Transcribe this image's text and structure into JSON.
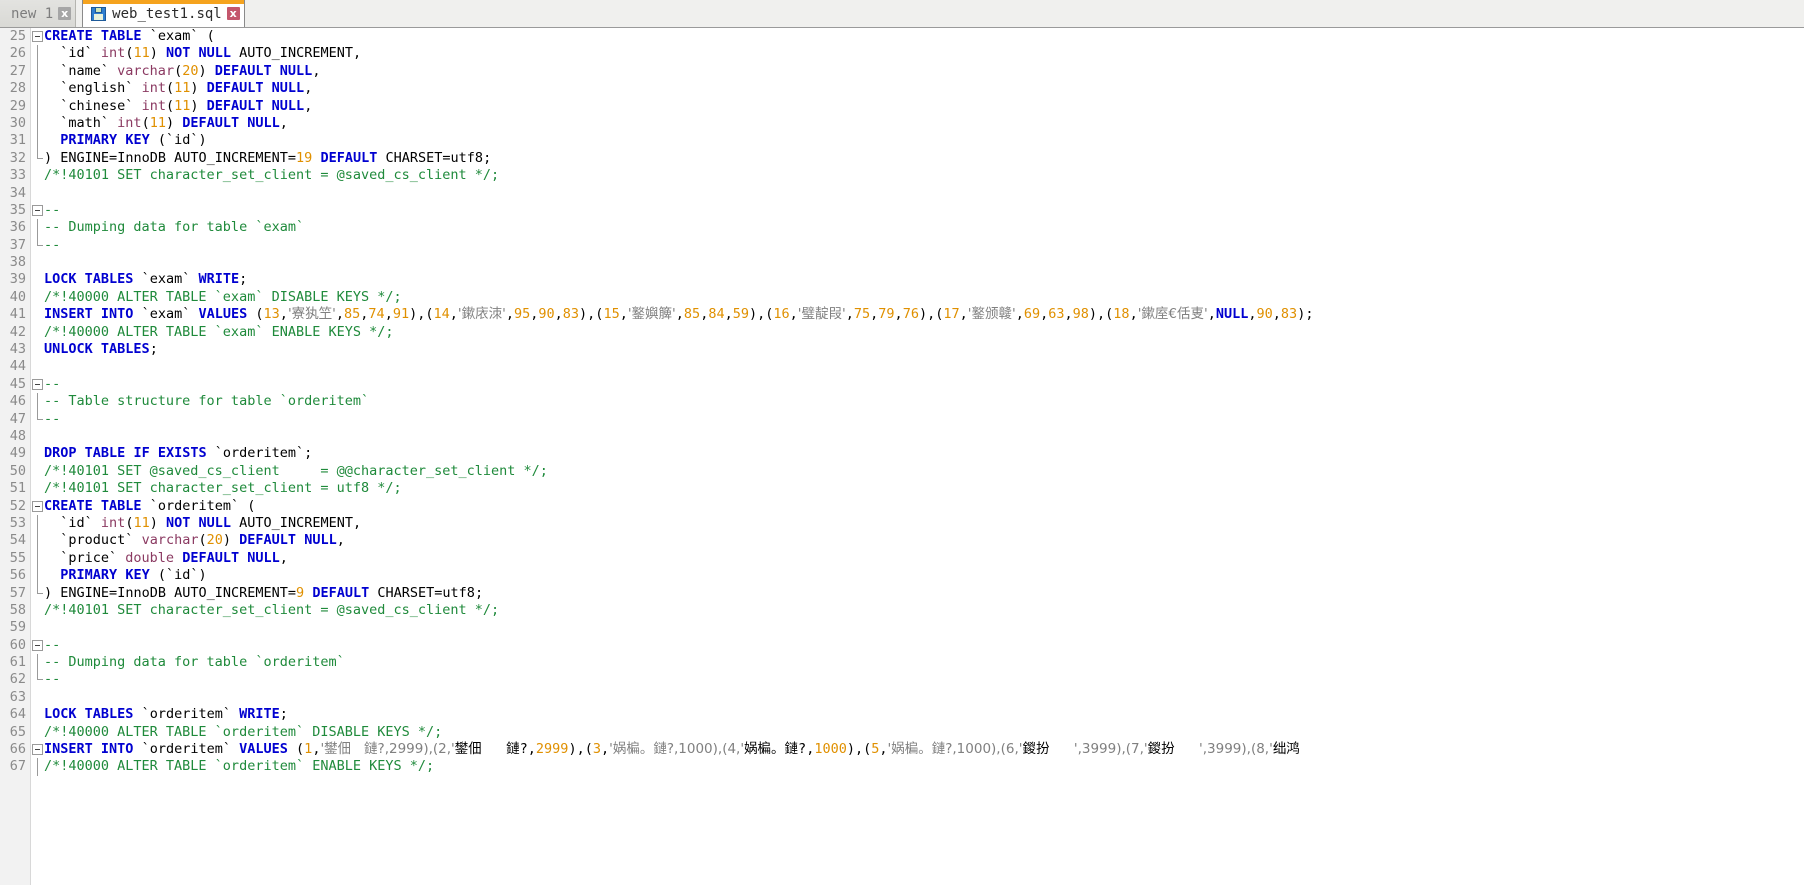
{
  "window": {
    "app": "text-editor",
    "accent_color": "#f5a31e",
    "tabbar_bg": "#f0f0ee",
    "editor_bg": "#ffffff",
    "gutter_bg": "#f2f2f2"
  },
  "tabs": [
    {
      "label": "new 1",
      "active": false,
      "modified": false,
      "close_label": "x",
      "close_color": "#a6a6a6",
      "has_icon": false
    },
    {
      "label": "web_test1.sql",
      "active": true,
      "modified": true,
      "close_label": "x",
      "close_color": "#c4566c",
      "has_icon": true,
      "icon": "save-icon"
    }
  ],
  "editor": {
    "language": "SQL",
    "first_line": 25,
    "last_line": 67,
    "colors": {
      "keyword": "#0000d0",
      "type": "#8b3a62",
      "number": "#e09000",
      "comment": "#1f8a3b",
      "string": "#808080",
      "plain": "#000000"
    },
    "lines": [
      {
        "n": 25,
        "fold": "box",
        "text": "CREATE TABLE `exam` ("
      },
      {
        "n": 26,
        "fold": "bar",
        "text": "  `id` int(11) NOT NULL AUTO_INCREMENT,"
      },
      {
        "n": 27,
        "fold": "bar",
        "text": "  `name` varchar(20) DEFAULT NULL,"
      },
      {
        "n": 28,
        "fold": "bar",
        "text": "  `english` int(11) DEFAULT NULL,"
      },
      {
        "n": 29,
        "fold": "bar",
        "text": "  `chinese` int(11) DEFAULT NULL,"
      },
      {
        "n": 30,
        "fold": "bar",
        "text": "  `math` int(11) DEFAULT NULL,"
      },
      {
        "n": 31,
        "fold": "bar",
        "text": "  PRIMARY KEY (`id`)"
      },
      {
        "n": 32,
        "fold": "end",
        "text": ") ENGINE=InnoDB AUTO_INCREMENT=19 DEFAULT CHARSET=utf8;"
      },
      {
        "n": 33,
        "fold": "none",
        "text": "/*!40101 SET character_set_client = @saved_cs_client */;"
      },
      {
        "n": 34,
        "fold": "none",
        "text": ""
      },
      {
        "n": 35,
        "fold": "box",
        "text": "--"
      },
      {
        "n": 36,
        "fold": "bar",
        "text": "-- Dumping data for table `exam`"
      },
      {
        "n": 37,
        "fold": "end",
        "text": "--"
      },
      {
        "n": 38,
        "fold": "none",
        "text": ""
      },
      {
        "n": 39,
        "fold": "none",
        "text": "LOCK TABLES `exam` WRITE;"
      },
      {
        "n": 40,
        "fold": "none",
        "text": "/*!40000 ALTER TABLE `exam` DISABLE KEYS */;"
      },
      {
        "n": 41,
        "fold": "none",
        "text": "INSERT INTO `exam` VALUES (13,'寮犱笁',85,74,91),(14,'鏉庡洓',95,90,83),(15,'鐜嬩簲',85,84,59),(16,'璧靛叚',75,79,76),(17,'鐜颁竷',69,63,98),(18,'鏉庢€佸叓',NULL,90,83);"
      },
      {
        "n": 42,
        "fold": "none",
        "text": "/*!40000 ALTER TABLE `exam` ENABLE KEYS */;"
      },
      {
        "n": 43,
        "fold": "none",
        "text": "UNLOCK TABLES;"
      },
      {
        "n": 44,
        "fold": "none",
        "text": ""
      },
      {
        "n": 45,
        "fold": "box",
        "text": "--"
      },
      {
        "n": 46,
        "fold": "bar",
        "text": "-- Table structure for table `orderitem`"
      },
      {
        "n": 47,
        "fold": "end",
        "text": "--"
      },
      {
        "n": 48,
        "fold": "none",
        "text": ""
      },
      {
        "n": 49,
        "fold": "none",
        "text": "DROP TABLE IF EXISTS `orderitem`;"
      },
      {
        "n": 50,
        "fold": "none",
        "text": "/*!40101 SET @saved_cs_client     = @@character_set_client */;"
      },
      {
        "n": 51,
        "fold": "none",
        "text": "/*!40101 SET character_set_client = utf8 */;"
      },
      {
        "n": 52,
        "fold": "box",
        "text": "CREATE TABLE `orderitem` ("
      },
      {
        "n": 53,
        "fold": "bar",
        "text": "  `id` int(11) NOT NULL AUTO_INCREMENT,"
      },
      {
        "n": 54,
        "fold": "bar",
        "text": "  `product` varchar(20) DEFAULT NULL,"
      },
      {
        "n": 55,
        "fold": "bar",
        "text": "  `price` double DEFAULT NULL,"
      },
      {
        "n": 56,
        "fold": "bar",
        "text": "  PRIMARY KEY (`id`)"
      },
      {
        "n": 57,
        "fold": "end",
        "text": ") ENGINE=InnoDB AUTO_INCREMENT=9 DEFAULT CHARSET=utf8;"
      },
      {
        "n": 58,
        "fold": "none",
        "text": "/*!40101 SET character_set_client = @saved_cs_client */;"
      },
      {
        "n": 59,
        "fold": "none",
        "text": ""
      },
      {
        "n": 60,
        "fold": "box",
        "text": "--"
      },
      {
        "n": 61,
        "fold": "bar",
        "text": "-- Dumping data for table `orderitem`"
      },
      {
        "n": 62,
        "fold": "end",
        "text": "--"
      },
      {
        "n": 63,
        "fold": "none",
        "text": ""
      },
      {
        "n": 64,
        "fold": "none",
        "text": "LOCK TABLES `orderitem` WRITE;"
      },
      {
        "n": 65,
        "fold": "none",
        "text": "/*!40000 ALTER TABLE `orderitem` DISABLE KEYS */;"
      },
      {
        "n": 66,
        "fold": "box",
        "text": "INSERT INTO `orderitem` VALUES (1,'鐢佃   鏈?,2999),(2,'鐢佃   鏈?,2999),(3,'娲楄。鏈?,1000),(4,'娲楄。鏈?,1000),(5,'娲楄。鏈?,1000),(6,'鍐扮   ',3999),(7,'鍐扮   ',3999),(8,'绌鸿"
      },
      {
        "n": 67,
        "fold": "bar",
        "text": "/*!40000 ALTER TABLE `orderitem` ENABLE KEYS */;"
      }
    ]
  }
}
